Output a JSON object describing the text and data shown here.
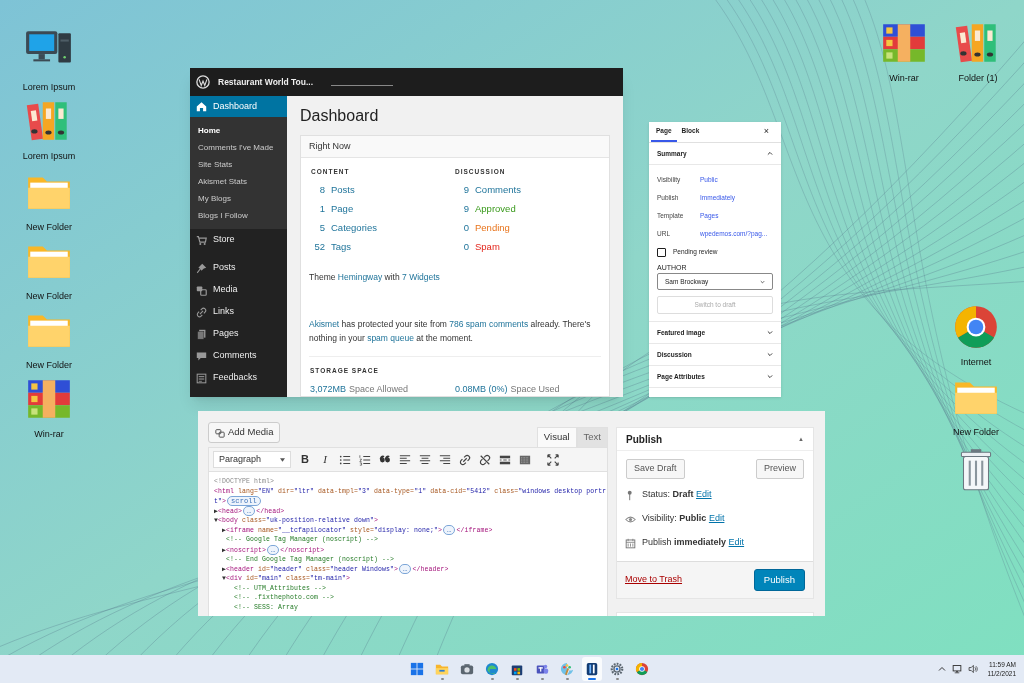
{
  "desktop_icons_left": [
    {
      "kind": "computer",
      "label": "Lorem Ipsum"
    },
    {
      "kind": "binders",
      "label": "Lorem Ipsum"
    },
    {
      "kind": "folder",
      "label": "New Folder"
    },
    {
      "kind": "folder",
      "label": "New Folder"
    },
    {
      "kind": "folder",
      "label": "New Folder"
    },
    {
      "kind": "archive",
      "label": "Win-rar"
    }
  ],
  "desktop_icons_right": [
    {
      "kind": "archive",
      "label": "Win-rar"
    },
    {
      "kind": "binders",
      "label": "Folder (1)"
    },
    {
      "kind": "browser",
      "label": "Internet"
    },
    {
      "kind": "folder",
      "label": "New Folder"
    },
    {
      "kind": "trash"
    }
  ],
  "dashboard_window": {
    "site_title": "Restaurant World Tou...",
    "menu": [
      {
        "kind": "home",
        "label": "Dashboard",
        "selected": true,
        "children": [
          {
            "label": "Home",
            "selected": true
          },
          {
            "label": "Comments I've Made",
            "selected": false
          },
          {
            "label": "Site Stats",
            "selected": false
          },
          {
            "label": "Akismet Stats",
            "selected": false
          },
          {
            "label": "My Blogs",
            "selected": false
          },
          {
            "label": "Blogs I Follow",
            "selected": false
          }
        ]
      },
      {
        "kind": "cart",
        "label": "Store",
        "selected": false
      },
      {
        "kind": "pin",
        "label": "Posts",
        "selected": false
      },
      {
        "kind": "media",
        "label": "Media",
        "selected": false
      },
      {
        "kind": "link",
        "label": "Links",
        "selected": false
      },
      {
        "kind": "pages",
        "label": "Pages",
        "selected": false
      },
      {
        "kind": "bubble",
        "label": "Comments",
        "selected": false
      },
      {
        "kind": "feedback",
        "label": "Feedbacks",
        "selected": false
      }
    ],
    "page_title": "Dashboard",
    "right_now": {
      "title": "Right Now",
      "content_heading": "CONTENT",
      "discussion_heading": "DISCUSSION",
      "content": [
        {
          "count": "8",
          "label": "Posts",
          "kind": "total"
        },
        {
          "count": "1",
          "label": "Page",
          "kind": "total"
        },
        {
          "count": "5",
          "label": "Categories",
          "kind": "total"
        },
        {
          "count": "52",
          "label": "Tags",
          "kind": "total"
        }
      ],
      "discussion": [
        {
          "count": "9",
          "label": "Comments",
          "kind": "total"
        },
        {
          "count": "9",
          "label": "Approved",
          "kind": "approved"
        },
        {
          "count": "0",
          "label": "Pending",
          "kind": "pending"
        },
        {
          "count": "0",
          "label": "Spam",
          "kind": "spam"
        }
      ],
      "theme_line": [
        {
          "text": "Theme ",
          "link": false
        },
        {
          "text": "Hemingway",
          "link": true
        },
        {
          "text": " with ",
          "link": false
        },
        {
          "text": "7 Widgets",
          "link": true
        }
      ],
      "akismet_line": [
        {
          "text": "Akismet",
          "link": true
        },
        {
          "text": " has protected your site from ",
          "link": false
        },
        {
          "text": "786 spam comments",
          "link": true
        },
        {
          "text": " already. There's nothing in your ",
          "link": false
        },
        {
          "text": "spam queue",
          "link": true
        },
        {
          "text": " at the moment.",
          "link": false
        }
      ],
      "storage_heading": "STORAGE SPACE",
      "storage": [
        {
          "amount": "3,072MB",
          "label": "Space Allowed"
        },
        {
          "amount": "0.08MB (0%)",
          "label": "Space Used"
        }
      ]
    }
  },
  "settings_panel": {
    "tabs": [
      {
        "label": "Page",
        "selected": true
      },
      {
        "label": "Block",
        "selected": false
      }
    ],
    "close": "×",
    "summary": {
      "title": "Summary",
      "expanded": true,
      "rows": [
        {
          "label": "Visibility",
          "value": "Public"
        },
        {
          "label": "Publish",
          "value": "Immediately"
        },
        {
          "label": "Template",
          "value": "Pages"
        },
        {
          "label": "URL",
          "value": "wpedemos.com/?pag..."
        }
      ],
      "pending_review": {
        "label": "Pending review",
        "checked": false
      },
      "author_label": "AUTHOR",
      "author": "Sam Brockway",
      "switch_button": {
        "label": "Switch to draft",
        "disabled": true
      }
    },
    "sections": [
      {
        "title": "Featured image",
        "expanded": false
      },
      {
        "title": "Discussion",
        "expanded": false
      },
      {
        "title": "Page Attributes",
        "expanded": false
      }
    ]
  },
  "editor_window": {
    "add_media": "Add Media",
    "tabs": [
      {
        "label": "Visual",
        "selected": true
      },
      {
        "label": "Text",
        "selected": false
      }
    ],
    "format": "Paragraph",
    "toolbar": [
      {
        "kind": "bold",
        "label": "B"
      },
      {
        "kind": "italic",
        "label": "I"
      },
      {
        "kind": "bullets"
      },
      {
        "kind": "numbers"
      },
      {
        "kind": "quote"
      },
      {
        "kind": "align-left"
      },
      {
        "kind": "align-center"
      },
      {
        "kind": "align-right"
      },
      {
        "kind": "link"
      },
      {
        "kind": "unlink"
      },
      {
        "kind": "more"
      },
      {
        "kind": "keyboard"
      },
      {
        "kind": "fullscreen"
      }
    ],
    "code_lines": [
      [
        {
          "kind": "doctype",
          "text": "<!DOCTYPE html>"
        }
      ],
      [
        {
          "kind": "tag",
          "text": "<html "
        },
        {
          "kind": "attr",
          "text": "lang="
        },
        {
          "kind": "value",
          "text": "\"EN\""
        },
        {
          "kind": "attr",
          "text": " dir="
        },
        {
          "kind": "value",
          "text": "\"ltr\""
        },
        {
          "kind": "attr",
          "text": " data-tmpl="
        },
        {
          "kind": "value",
          "text": "\"3\""
        },
        {
          "kind": "attr",
          "text": " data-type="
        },
        {
          "kind": "value",
          "text": "\"1\""
        },
        {
          "kind": "attr",
          "text": " data-cid="
        },
        {
          "kind": "value",
          "text": "\"5412\""
        },
        {
          "kind": "attr",
          "text": " class="
        },
        {
          "kind": "value",
          "text": "\"windows desktop portr"
        }
      ],
      [
        {
          "kind": "value",
          "text": "t\""
        },
        {
          "kind": "tag",
          "text": ">"
        },
        {
          "kind": "badge",
          "text": "scroll"
        }
      ],
      [
        {
          "kind": "toggle",
          "text": "▶"
        },
        {
          "kind": "tag",
          "text": "<head>"
        },
        {
          "kind": "badge",
          "text": "…"
        },
        {
          "kind": "tag",
          "text": "</head>"
        }
      ],
      [
        {
          "kind": "toggle",
          "text": "▼"
        },
        {
          "kind": "tag",
          "text": "<body "
        },
        {
          "kind": "attr",
          "text": "class="
        },
        {
          "kind": "value",
          "text": "\"uk-position-relative down\""
        },
        {
          "kind": "tag",
          "text": ">"
        }
      ],
      [
        {
          "kind": "toggle",
          "text": "  ▶"
        },
        {
          "kind": "tag",
          "text": "<iframe "
        },
        {
          "kind": "attr",
          "text": "name="
        },
        {
          "kind": "value",
          "text": "\"__tcfapiLocator\""
        },
        {
          "kind": "attr",
          "text": " style="
        },
        {
          "kind": "value",
          "text": "\"display: none;\""
        },
        {
          "kind": "tag",
          "text": ">"
        },
        {
          "kind": "badge",
          "text": "…"
        },
        {
          "kind": "tag",
          "text": "</iframe>"
        }
      ],
      [
        {
          "kind": "comment",
          "text": "   <!-- Google Tag Manager (noscript) -->"
        }
      ],
      [
        {
          "kind": "toggle",
          "text": "  ▶"
        },
        {
          "kind": "tag",
          "text": "<noscript>"
        },
        {
          "kind": "badge",
          "text": "…"
        },
        {
          "kind": "tag",
          "text": "</noscript>"
        }
      ],
      [
        {
          "kind": "comment",
          "text": "   <!-- End Google Tag Manager (noscript) -->"
        }
      ],
      [
        {
          "kind": "toggle",
          "text": "  ▶"
        },
        {
          "kind": "tag",
          "text": "<header "
        },
        {
          "kind": "attr",
          "text": "id="
        },
        {
          "kind": "value",
          "text": "\"header\""
        },
        {
          "kind": "attr",
          "text": " class="
        },
        {
          "kind": "value",
          "text": "\"header Windows\""
        },
        {
          "kind": "tag",
          "text": ">"
        },
        {
          "kind": "badge",
          "text": "…"
        },
        {
          "kind": "tag",
          "text": "</header>"
        }
      ],
      [
        {
          "kind": "toggle",
          "text": "  ▼"
        },
        {
          "kind": "tag",
          "text": "<div "
        },
        {
          "kind": "attr",
          "text": "id="
        },
        {
          "kind": "value",
          "text": "\"main\""
        },
        {
          "kind": "attr",
          "text": " class="
        },
        {
          "kind": "value",
          "text": "\"tm-main\""
        },
        {
          "kind": "tag",
          "text": ">"
        }
      ],
      [
        {
          "kind": "comment",
          "text": "     <!-- UTM_Attributes -->"
        }
      ],
      [
        {
          "kind": "comment",
          "text": "     <!-- .fixthephoto.com -->"
        }
      ],
      [
        {
          "kind": "comment",
          "text": "     <!-- SESS: Array"
        }
      ]
    ],
    "publish_box": {
      "title": "Publish",
      "toggle": "▲",
      "save_draft": "Save Draft",
      "preview": "Preview",
      "rows": [
        {
          "kind": "pin",
          "label": "Status: ",
          "value": "Draft",
          "action": "Edit"
        },
        {
          "kind": "eye",
          "label": "Visibility: ",
          "value": "Public",
          "action": "Edit"
        },
        {
          "kind": "calendar",
          "label": "Publish ",
          "value": "immediately",
          "action": "Edit"
        }
      ],
      "trash": "Move to Trash",
      "publish": "Publish"
    }
  },
  "taskbar": {
    "apps": [
      {
        "kind": "start",
        "running": false,
        "selected": false
      },
      {
        "kind": "explorer",
        "running": true,
        "selected": false
      },
      {
        "kind": "camera",
        "running": false,
        "selected": false
      },
      {
        "kind": "edge",
        "running": true,
        "selected": false
      },
      {
        "kind": "store",
        "running": true,
        "selected": false
      },
      {
        "kind": "teams",
        "running": true,
        "selected": false
      },
      {
        "kind": "paint",
        "running": true,
        "selected": false
      },
      {
        "kind": "app",
        "running": true,
        "selected": true
      },
      {
        "kind": "settings",
        "running": true,
        "selected": false
      },
      {
        "kind": "browser",
        "running": false,
        "selected": false
      }
    ],
    "time": "11:59 AM",
    "date": "11/2/2021"
  }
}
